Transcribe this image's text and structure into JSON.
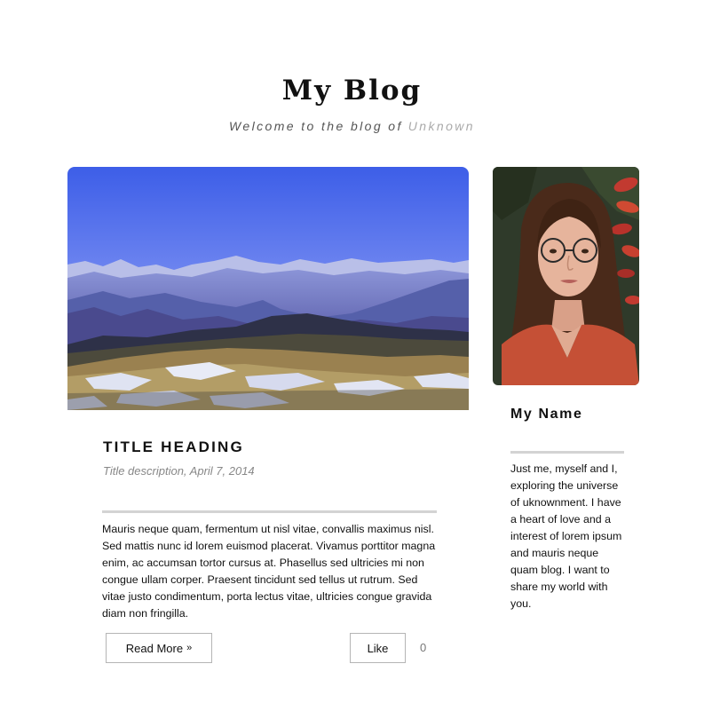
{
  "header": {
    "title": "My Blog",
    "subtitle": "Welcome to the blog of",
    "author": "Unknown"
  },
  "post": {
    "title": "TITLE HEADING",
    "meta": "Title description, April 7, 2014",
    "body": "Mauris neque quam, fermentum ut nisl vitae, convallis maximus nisl. Sed mattis nunc id lorem euismod placerat. Vivamus porttitor magna enim, ac accumsan tortor cursus at. Phasellus sed ultricies mi non congue ullam corper. Praesent tincidunt sed tellus ut rutrum. Sed vitae justo condimentum, porta lectus vitae, ultricies congue gravida diam non fringilla.",
    "read_more_label": "Read More",
    "read_more_icon": "»",
    "like_label": "Like",
    "like_count": "0"
  },
  "profile": {
    "name": "My Name",
    "bio": "Just me, myself and I, exploring the universe of uknownment. I have a heart of love and a interest of lorem ipsum and mauris neque quam blog. I want to share my world with you."
  },
  "colors": {
    "divider": "#d3d3d3",
    "button_border": "#b5b5b5",
    "subtitle_author": "#aaaaaa"
  }
}
